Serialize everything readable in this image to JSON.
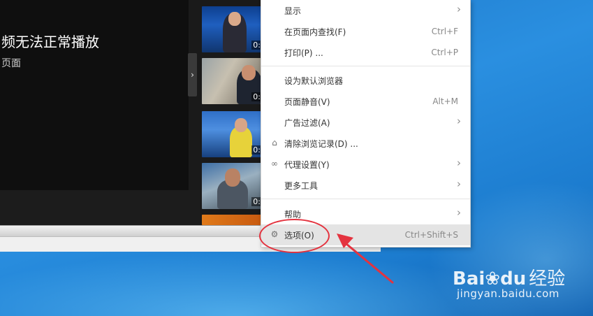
{
  "player": {
    "error_title": "频无法正常播放",
    "error_sub": "页面",
    "collapse_glyph": "›"
  },
  "thumbs": [
    {
      "duration": "0:"
    },
    {
      "duration": "0:"
    },
    {
      "duration": "0:"
    },
    {
      "duration": "0:"
    }
  ],
  "menu": {
    "items": [
      {
        "label": "显示",
        "shortcut": "",
        "submenu": true
      },
      {
        "label": "在页面内查找(F)",
        "shortcut": "Ctrl+F",
        "submenu": false
      },
      {
        "label": "打印(P) ...",
        "shortcut": "Ctrl+P",
        "submenu": false
      },
      {
        "label": "设为默认浏览器",
        "shortcut": "",
        "submenu": false
      },
      {
        "label": "页面静音(V)",
        "shortcut": "Alt+M",
        "submenu": false
      },
      {
        "label": "广告过滤(A)",
        "shortcut": "",
        "submenu": true
      },
      {
        "label": "清除浏览记录(D) ...",
        "shortcut": "",
        "submenu": false,
        "icon": "eraser-icon"
      },
      {
        "label": "代理设置(Y)",
        "shortcut": "",
        "submenu": true,
        "icon": "link-icon"
      },
      {
        "label": "更多工具",
        "shortcut": "",
        "submenu": true
      },
      {
        "label": "帮助",
        "shortcut": "",
        "submenu": true
      },
      {
        "label": "选项(O)",
        "shortcut": "Ctrl+Shift+S",
        "submenu": false,
        "icon": "gear-icon",
        "highlighted": true
      }
    ],
    "submenu_glyph": "›"
  },
  "annotation": {
    "color": "#e4333f"
  },
  "watermark": {
    "brand": "Bai",
    "brand_paw": "du",
    "brand_cn": "经验",
    "url": "jingyan.baidu.com"
  }
}
